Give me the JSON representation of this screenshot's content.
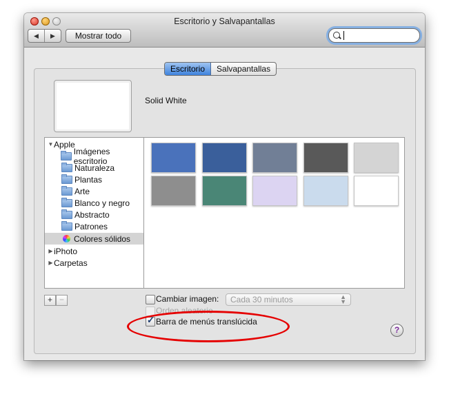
{
  "window": {
    "title": "Escritorio y Salvapantallas"
  },
  "toolbar": {
    "back_glyph": "◀",
    "forward_glyph": "▶",
    "show_all": "Mostrar todo",
    "search_placeholder": ""
  },
  "tabs": [
    {
      "label": "Escritorio",
      "active": true
    },
    {
      "label": "Salvapantallas",
      "active": false
    }
  ],
  "preview": {
    "name": "Solid White"
  },
  "sidebar": {
    "groups": [
      {
        "label": "Apple",
        "expanded": true,
        "disclosure": "▼"
      },
      {
        "label": "iPhoto",
        "expanded": false,
        "disclosure": "▶"
      },
      {
        "label": "Carpetas",
        "expanded": false,
        "disclosure": "▶"
      }
    ],
    "items": [
      {
        "label": "Imágenes escritorio",
        "icon": "folder-icon"
      },
      {
        "label": "Naturaleza",
        "icon": "folder-icon"
      },
      {
        "label": "Plantas",
        "icon": "folder-icon"
      },
      {
        "label": "Arte",
        "icon": "folder-icon"
      },
      {
        "label": "Blanco y negro",
        "icon": "folder-icon"
      },
      {
        "label": "Abstracto",
        "icon": "folder-icon"
      },
      {
        "label": "Patrones",
        "icon": "folder-icon"
      },
      {
        "label": "Colores sólidos",
        "icon": "color-wheel-icon",
        "selected": true
      }
    ]
  },
  "swatches": [
    "#4a72bb",
    "#3a5f9b",
    "#717f96",
    "#595959",
    "#d4d4d4",
    "#8e8e8e",
    "#4a8676",
    "#dcd4f2",
    "#cadbed",
    "#ffffff"
  ],
  "list_buttons": {
    "add": "+",
    "remove": "−"
  },
  "options": {
    "change_picture": {
      "label": "Cambiar imagen:",
      "checked": false
    },
    "interval": "Cada 30 minutos",
    "random_order": {
      "label": "Orden aleatorio",
      "checked": false,
      "enabled": false
    },
    "translucent_menu": {
      "label": "Barra de menús translúcida",
      "checked": true,
      "check_glyph": "✓"
    }
  },
  "help": {
    "glyph": "?"
  },
  "annotation_color": "#e50000"
}
